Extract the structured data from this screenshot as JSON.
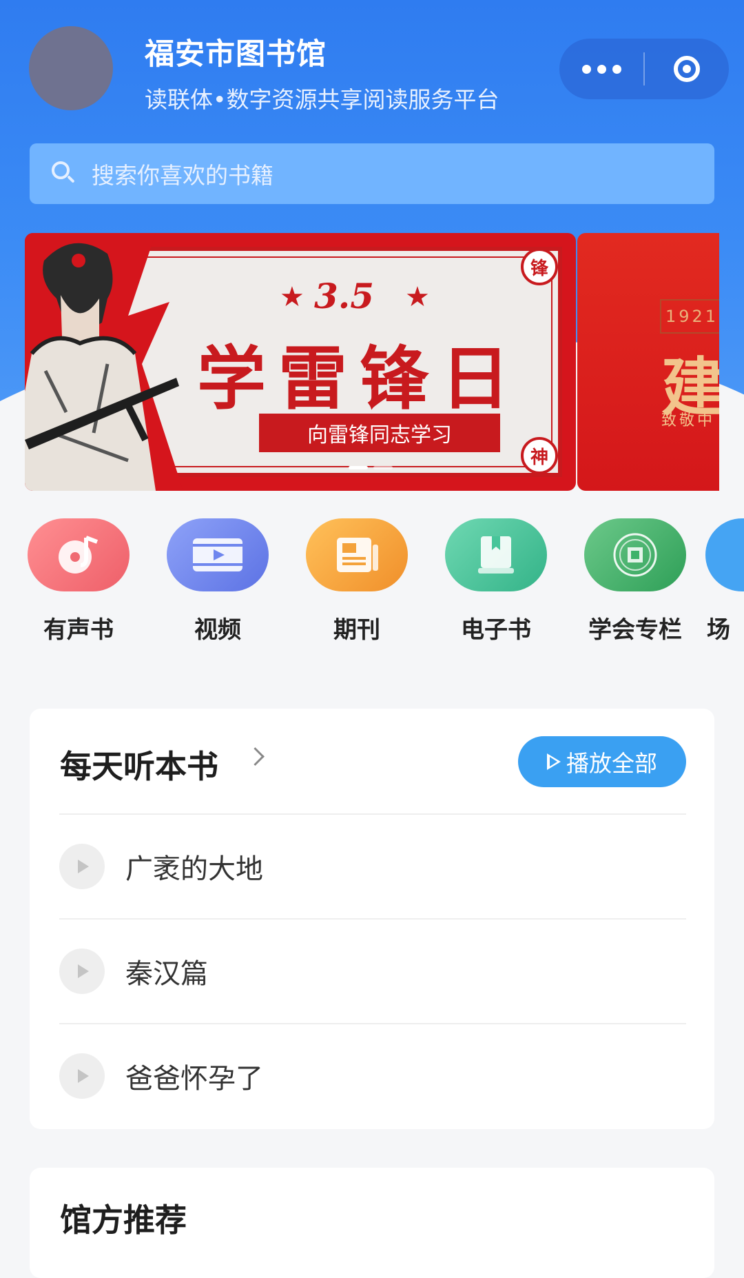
{
  "header": {
    "title": "福安市图书馆",
    "subtitle": "读联体•数字资源共享阅读服务平台",
    "more_icon": "more-dots-icon",
    "close_icon": "target-circle-icon"
  },
  "search": {
    "placeholder": "搜索你喜欢的书籍"
  },
  "banner": {
    "date": "3.5",
    "headline": "学雷锋日",
    "ribbon": "向雷锋同志学习",
    "seal_top": "锋",
    "seal_bottom": "神",
    "next_year": "1921",
    "next_char": "建",
    "next_sub": "致敬中"
  },
  "categories": [
    {
      "label": "有声书",
      "icon": "music-disc-icon",
      "color": "#f26b73"
    },
    {
      "label": "视频",
      "icon": "video-film-icon",
      "color": "#6f86ee"
    },
    {
      "label": "期刊",
      "icon": "newspaper-icon",
      "color": "#f4a23a"
    },
    {
      "label": "电子书",
      "icon": "book-icon",
      "color": "#47c59a"
    },
    {
      "label": "学会专栏",
      "icon": "society-emblem-icon",
      "color": "#3fb36a"
    },
    {
      "label": "场",
      "icon": "venue-icon",
      "color": "#45a4f3"
    }
  ],
  "daily": {
    "title": "每天听本书",
    "play_all": "播放全部",
    "tracks": [
      "广袤的大地",
      "秦汉篇",
      "爸爸怀孕了"
    ]
  },
  "recommend": {
    "title": "馆方推荐"
  }
}
